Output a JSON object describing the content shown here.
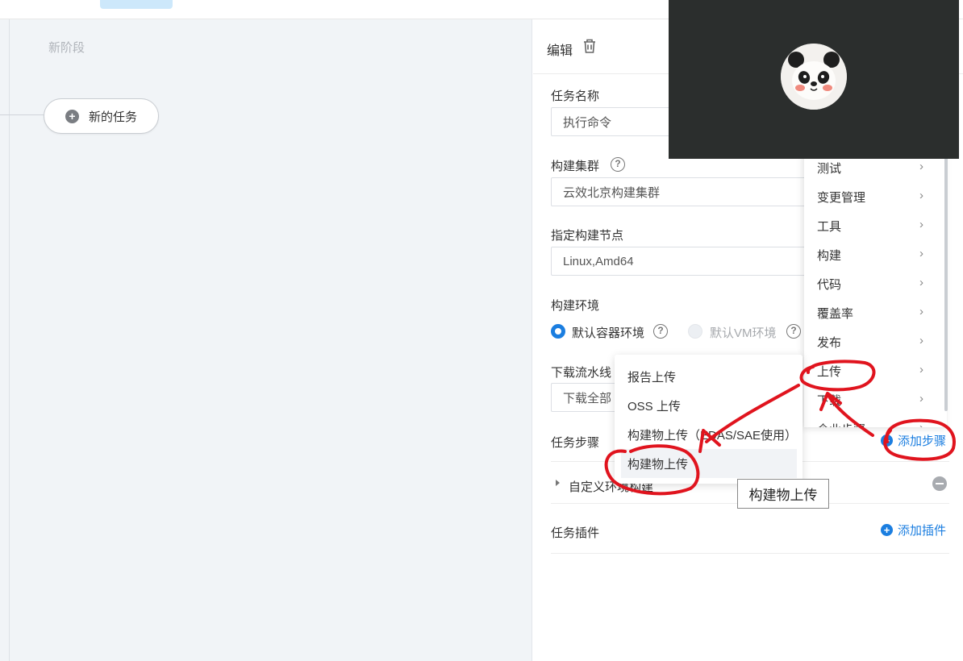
{
  "canvas": {
    "stage_title": "新阶段",
    "new_task_label": "新的任务"
  },
  "panel": {
    "title": "编辑",
    "task_name_label": "任务名称",
    "task_name_value": "执行命令",
    "build_cluster_label": "构建集群",
    "build_cluster_value": "云效北京构建集群",
    "build_node_label": "指定构建节点",
    "build_node_value": "Linux,Amd64",
    "build_env_label": "构建环境",
    "env_option_container": "默认容器环境",
    "env_option_vm": "默认VM环境",
    "download_label": "下载流水线",
    "download_value": "下载全部",
    "task_steps_label": "任务步骤",
    "add_step_label": "添加步骤",
    "step_name": "自定义环境构建",
    "task_plugins_label": "任务插件",
    "add_plugin_label": "添加插件"
  },
  "category_menu": {
    "items": [
      "测试",
      "变更管理",
      "工具",
      "构建",
      "代码",
      "覆盖率",
      "发布",
      "上传",
      "下载",
      "企业步骤"
    ]
  },
  "sub_menu": {
    "items": [
      "报告上传",
      "OSS 上传",
      "构建物上传（EDAS/SAE使用）",
      "构建物上传"
    ]
  },
  "tooltip": {
    "text": "构建物上传"
  },
  "colors": {
    "accent": "#1b7ee0",
    "annotation": "#e0141e",
    "video_bg": "#2b2e2d"
  }
}
